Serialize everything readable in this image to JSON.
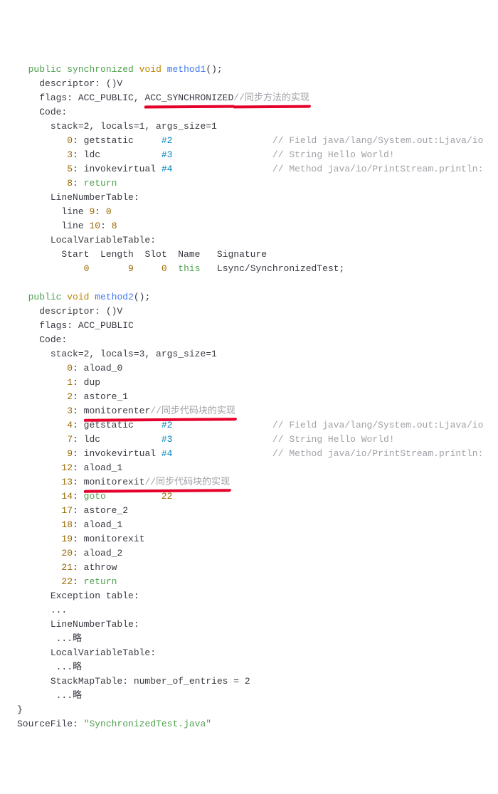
{
  "m1": {
    "decl_public": "public",
    "decl_sync": "synchronized",
    "decl_void": "void",
    "decl_name": "method1",
    "decl_rest": "();",
    "descriptor": "descriptor: ()V",
    "flags_pre": "flags: ACC_PUBLIC, ",
    "flags_acc": "ACC_SYNCHRONIZED",
    "flags_cmt": "//同步方法的实现",
    "code": "Code:",
    "stack": "stack=2, locals=1, args_size=1",
    "i0_off": "0",
    "i0_op": "getstatic",
    "i0_ref": "#2",
    "i0_cmt": "// Field java/lang/System.out:Ljava/io",
    "i1_off": "3",
    "i1_op": "ldc",
    "i1_ref": "#3",
    "i1_cmt": "// String Hello World!",
    "i2_off": "5",
    "i2_op": "invokevirtual",
    "i2_ref": "#4",
    "i2_cmt": "// Method java/io/PrintStream.println:",
    "i3_off": "8",
    "i3_op": "return",
    "lnt": "LineNumberTable:",
    "lnt0_a": "line",
    "lnt0_b": "9",
    "lnt0_c": ":",
    "lnt0_d": "0",
    "lnt1_a": "line",
    "lnt1_b": "10",
    "lnt1_c": ":",
    "lnt1_d": "8",
    "lvt": "LocalVariableTable:",
    "lvt_hdr": "Start  Length  Slot  Name   Signature",
    "lvt0_a": "0",
    "lvt0_b": "9",
    "lvt0_c": "0",
    "lvt0_d": "this",
    "lvt0_e": "Lsync/SynchronizedTest;"
  },
  "m2": {
    "decl_public": "public",
    "decl_void": "void",
    "decl_name": "method2",
    "decl_rest": "();",
    "descriptor": "descriptor: ()V",
    "flags": "flags: ACC_PUBLIC",
    "code": "Code:",
    "stack": "stack=2, locals=3, args_size=1",
    "i0_off": "0",
    "i0_op": "aload_0",
    "i1_off": "1",
    "i1_op": "dup",
    "i2_off": "2",
    "i2_op": "astore_1",
    "i3_off": "3",
    "i3_op": "monitorenter",
    "i3_cmt": "//同步代码块的实现",
    "i4_off": "4",
    "i4_op": "getstatic",
    "i4_ref": "#2",
    "i4_cmt": "// Field java/lang/System.out:Ljava/io",
    "i5_off": "7",
    "i5_op": "ldc",
    "i5_ref": "#3",
    "i5_cmt": "// String Hello World!",
    "i6_off": "9",
    "i6_op": "invokevirtual",
    "i6_ref": "#4",
    "i6_cmt": "// Method java/io/PrintStream.println:",
    "i7_off": "12",
    "i7_op": "aload_1",
    "i8_off": "13",
    "i8_op": "monitorexit",
    "i8_cmt": "//同步代码块的实现",
    "i9_off": "14",
    "i9_op": "goto",
    "i9_ref": "22",
    "i10_off": "17",
    "i10_op": "astore_2",
    "i11_off": "18",
    "i11_op": "aload_1",
    "i12_off": "19",
    "i12_op": "monitorexit",
    "i13_off": "20",
    "i13_op": "aload_2",
    "i14_off": "21",
    "i14_op": "athrow",
    "i15_off": "22",
    "i15_op": "return",
    "exc": "Exception table:",
    "dots": "...",
    "lnt": "LineNumberTable:",
    "omit": "...略",
    "lvt": "LocalVariableTable:",
    "smt": "StackMapTable: number_of_entries = 2"
  },
  "close": "}",
  "src_lbl": "SourceFile:",
  "src_val": "\"SynchronizedTest.java\""
}
